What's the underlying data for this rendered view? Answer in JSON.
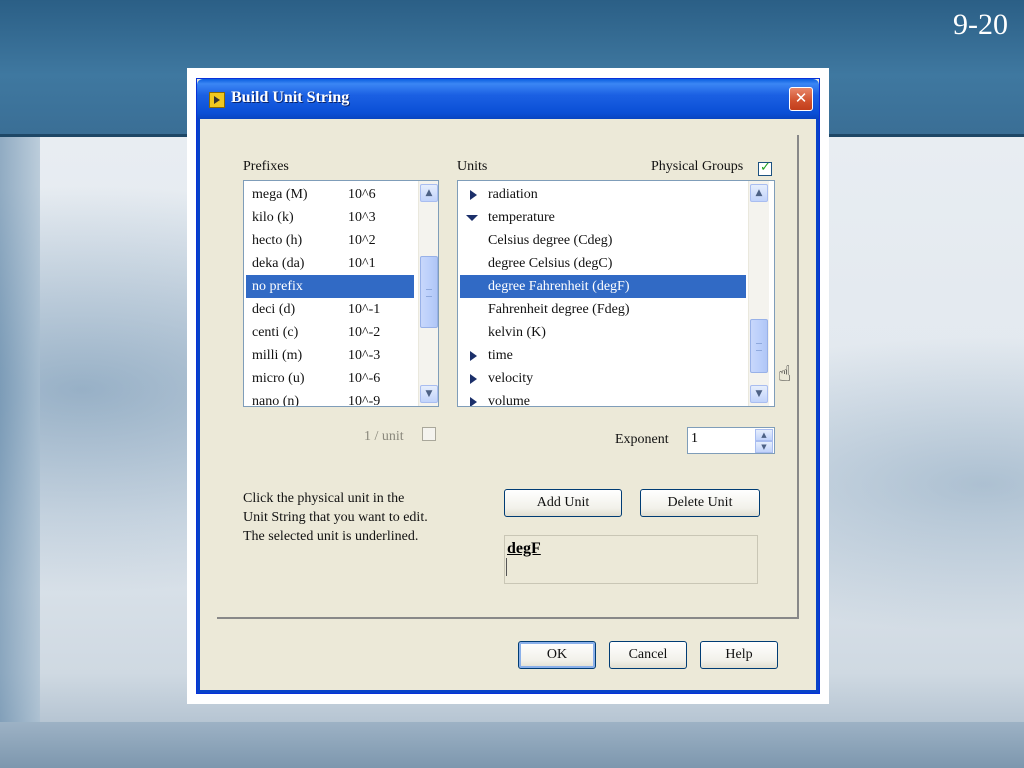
{
  "slide": {
    "page_number": "9-20"
  },
  "dialog": {
    "title": "Build Unit String",
    "close_icon": "close-icon"
  },
  "prefixes": {
    "label": "Prefixes",
    "items": [
      {
        "name": "mega (M)",
        "value": "10^6"
      },
      {
        "name": "kilo (k)",
        "value": "10^3"
      },
      {
        "name": "hecto (h)",
        "value": "10^2"
      },
      {
        "name": "deka (da)",
        "value": "10^1"
      },
      {
        "name": "no prefix",
        "value": ""
      },
      {
        "name": "deci  (d)",
        "value": "10^-1"
      },
      {
        "name": "centi  (c)",
        "value": "10^-2"
      },
      {
        "name": "milli  (m)",
        "value": "10^-3"
      },
      {
        "name": "micro (u)",
        "value": "10^-6"
      },
      {
        "name": "nano (n)",
        "value": "10^-9"
      }
    ],
    "selected": "no prefix"
  },
  "units": {
    "label": "Units",
    "physical_groups_label": "Physical Groups",
    "physical_groups_checked": true,
    "items": [
      {
        "text": "radiation",
        "kind": "group-collapsed"
      },
      {
        "text": "temperature",
        "kind": "group-expanded"
      },
      {
        "text": "Celsius degree (Cdeg)",
        "kind": "unit"
      },
      {
        "text": "degree Celsius (degC)",
        "kind": "unit"
      },
      {
        "text": "degree Fahrenheit (degF)",
        "kind": "unit"
      },
      {
        "text": "Fahrenheit degree (Fdeg)",
        "kind": "unit"
      },
      {
        "text": "kelvin (K)",
        "kind": "unit"
      },
      {
        "text": "time",
        "kind": "group-collapsed"
      },
      {
        "text": "velocity",
        "kind": "group-collapsed"
      },
      {
        "text": "volume",
        "kind": "group-collapsed"
      }
    ],
    "selected": "degree Fahrenheit (degF)"
  },
  "one_over_unit": {
    "label": "1 / unit",
    "checked": false
  },
  "exponent": {
    "label": "Exponent",
    "value": "1"
  },
  "help_text": {
    "line1": "Click the physical unit in the",
    "line2": "Unit String that you want to edit.",
    "line3": "The selected unit is underlined."
  },
  "buttons": {
    "add_unit": "Add Unit",
    "delete_unit": "Delete Unit",
    "ok": "OK",
    "cancel": "Cancel",
    "help": "Help"
  },
  "unit_string": {
    "value": "degF"
  }
}
